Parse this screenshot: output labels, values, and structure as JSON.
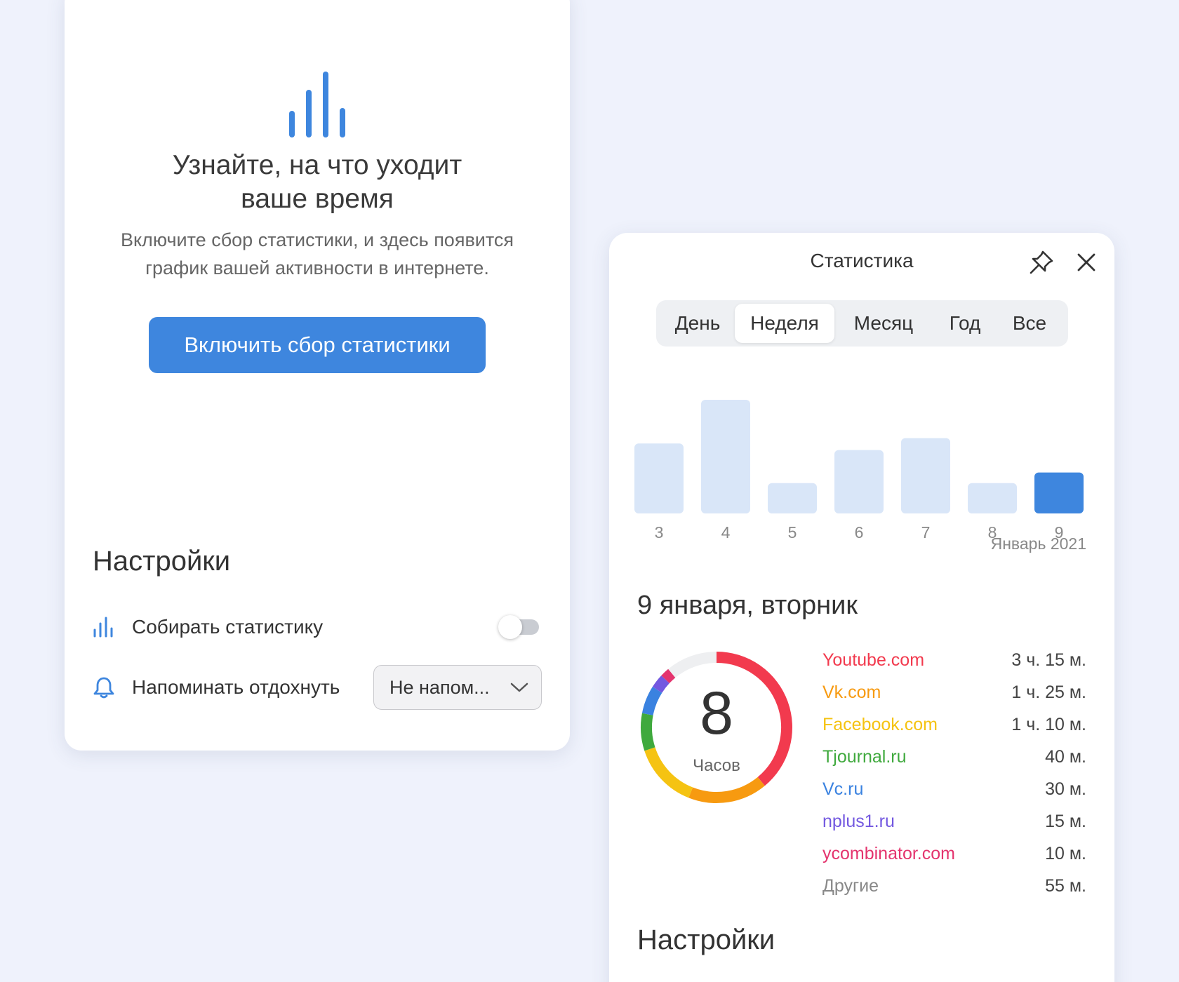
{
  "left": {
    "hero_title": "Узнайте, на что уходит ваше время",
    "hero_desc": "Включите сбор статистики, и здесь появится график вашей активности в интернете.",
    "enable_button": "Включить сбор статистики",
    "settings_title": "Настройки",
    "collect_label": "Собирать статистику",
    "collect_enabled": false,
    "remind_label": "Напоминать отдохнуть",
    "remind_value": "Не напом...",
    "icons": {
      "hero": "bar-chart-icon",
      "collect": "bar-chart-icon",
      "remind": "bell-icon",
      "select": "chevron-down-icon"
    }
  },
  "right": {
    "title": "Статистика",
    "icons": {
      "pin": "pin-icon",
      "close": "close-icon"
    },
    "tabs": [
      {
        "label": "День",
        "active": false
      },
      {
        "label": "Неделя",
        "active": true
      },
      {
        "label": "Месяц",
        "active": false
      },
      {
        "label": "Год",
        "active": false
      },
      {
        "label": "Все",
        "active": false
      }
    ],
    "chart_month": "Январь 2021",
    "day_title": "9 января, вторник",
    "donut_number": "8",
    "donut_unit": "Часов",
    "sites": [
      {
        "name": "Youtube.com",
        "time": "3 ч. 15 м.",
        "color": "#f23a4e"
      },
      {
        "name": "Vk.com",
        "time": "1 ч. 25 м.",
        "color": "#f79a10"
      },
      {
        "name": "Facebook.com",
        "time": "1 ч. 10 м.",
        "color": "#f5c312"
      },
      {
        "name": "Tjournal.ru",
        "time": "40 м.",
        "color": "#3fa93d"
      },
      {
        "name": "Vc.ru",
        "time": "30 м.",
        "color": "#3a82e0"
      },
      {
        "name": "nplus1.ru",
        "time": "15 м.",
        "color": "#7358e0"
      },
      {
        "name": "ycombinator.com",
        "time": "10 м.",
        "color": "#e4346e"
      },
      {
        "name": "Другие",
        "time": "55 м.",
        "color": "#888888"
      }
    ],
    "settings_title": "Настройки"
  },
  "colors": {
    "accent": "#3e86de",
    "bar_inactive": "#d9e6f8",
    "bar_active": "#3e86de",
    "others_ring": "#eeeff1"
  },
  "chart_data": {
    "type": "bar",
    "categories": [
      "3",
      "4",
      "5",
      "6",
      "7",
      "8",
      "9"
    ],
    "values": [
      5.3,
      8.6,
      2.3,
      4.8,
      5.7,
      2.3,
      3.1
    ],
    "highlighted": "9",
    "xlabel": "Январь 2021",
    "ylabel": "",
    "grid": false
  }
}
